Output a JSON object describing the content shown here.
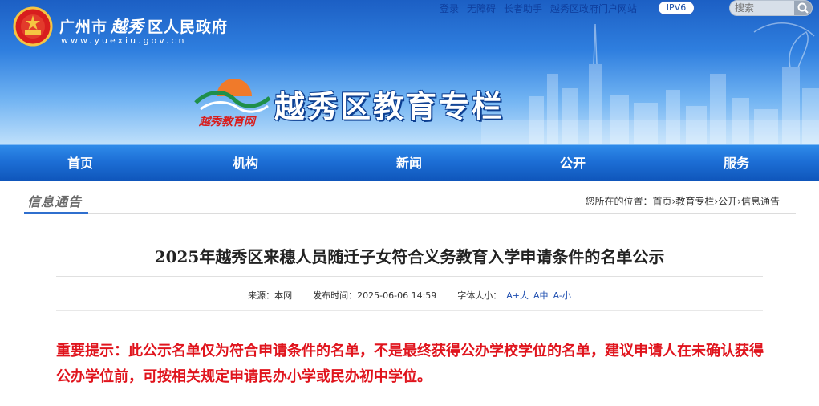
{
  "header": {
    "city_name_left": "广州市",
    "city_name_script": "越秀",
    "city_name_right": "区人民政府",
    "domain": "www.yuexiu.gov.cn",
    "top_links": [
      "登录",
      "无障碍",
      "长者助手",
      "越秀区政府门户网站"
    ],
    "ipv6_label": "IPV6",
    "search_placeholder": "搜索",
    "section_title": "越秀区教育专栏",
    "logo_caption": "越秀教育网"
  },
  "nav": {
    "items": [
      "首页",
      "机构",
      "新闻",
      "公开",
      "服务"
    ]
  },
  "infobar": {
    "title": "信息通告",
    "breadcrumb_prefix": "您所在的位置：",
    "breadcrumb": [
      "首页",
      "教育专栏",
      "公开",
      "信息通告"
    ],
    "breadcrumb_sep": "›"
  },
  "article": {
    "title": "2025年越秀区来穗人员随迁子女符合义务教育入学申请条件的名单公示",
    "source_label": "来源：",
    "source_value": "本网",
    "publish_label": "发布时间：",
    "publish_value": "2025-06-06 14:59",
    "font_label": "字体大小：",
    "font_options": [
      "A+大",
      "A中",
      "A-小"
    ],
    "notice": "重要提示：此公示名单仅为符合申请条件的名单，不是最终获得公办学校学位的名单，建议申请人在未确认获得公办学位前，可按相关规定申请民办小学或民办初中学位。"
  },
  "colors": {
    "banner_top": "#1c5fc4",
    "nav": "#1d6fd6",
    "notice_red": "#e0141d",
    "link_blue": "#1f4fb0"
  }
}
